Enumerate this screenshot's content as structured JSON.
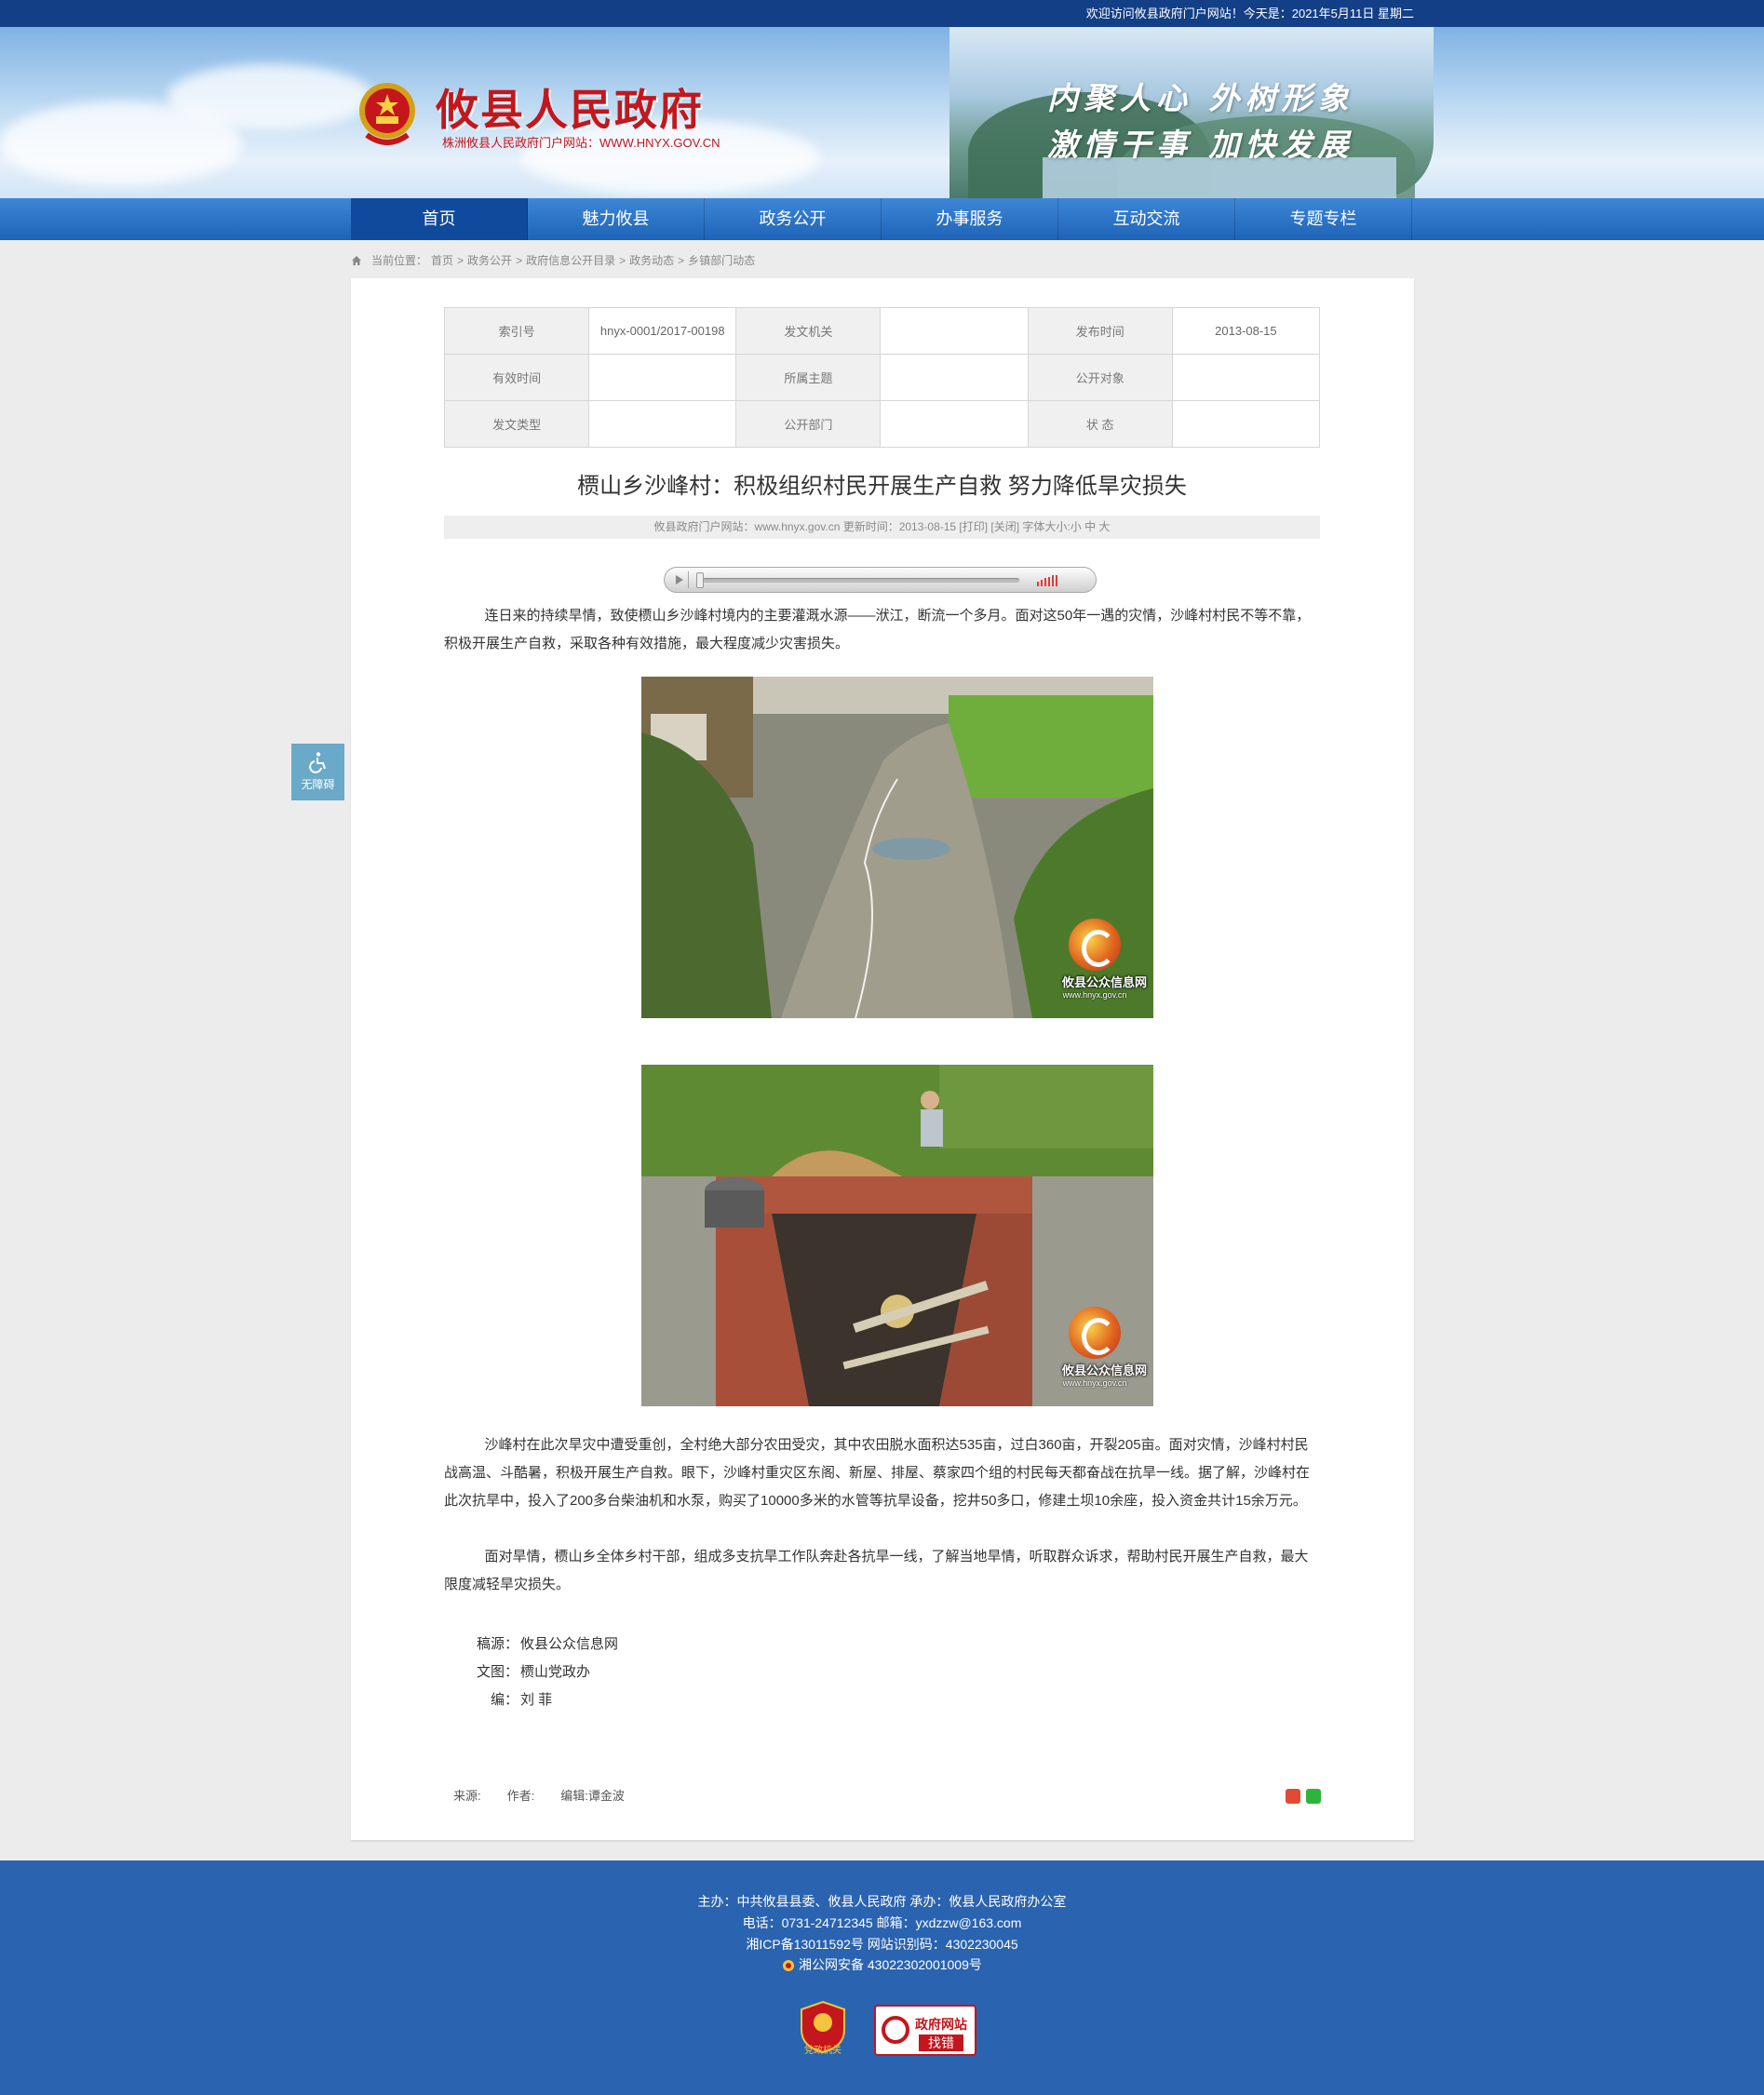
{
  "topbar": {
    "welcome": "欢迎访问攸县政府门户网站！今天是：2021年5月11日 星期二"
  },
  "header": {
    "site_title": "攸县人民政府",
    "site_subtitle": "株洲攸县人民政府门户网站：WWW.HNYX.GOV.CN",
    "slogan_line1": "内聚人心  外树形象",
    "slogan_line2": "激情干事  加快发展",
    "brand_red": "#c4161c",
    "nav_blue": "#1e63b7"
  },
  "nav": {
    "items": [
      "首页",
      "魅力攸县",
      "政务公开",
      "办事服务",
      "互动交流",
      "专题专栏"
    ]
  },
  "breadcrumb": {
    "prefix": "当前位置：",
    "items": [
      "首页",
      "政务公开",
      "政府信息公开目录",
      "政务动态",
      "乡镇部门动态"
    ],
    "separator": ">"
  },
  "meta": {
    "rows": [
      [
        {
          "k": "索引号",
          "v": "hnyx-0001/2017-00198"
        },
        {
          "k": "发文机关",
          "v": ""
        },
        {
          "k": "发布时间",
          "v": "2013-08-15"
        }
      ],
      [
        {
          "k": "有效时间",
          "v": ""
        },
        {
          "k": "所属主题",
          "v": ""
        },
        {
          "k": "公开对象",
          "v": ""
        }
      ],
      [
        {
          "k": "发文类型",
          "v": ""
        },
        {
          "k": "公开部门",
          "v": ""
        },
        {
          "k": "状  态",
          "v": ""
        }
      ]
    ]
  },
  "article": {
    "title": "槚山乡沙峰村：积极组织村民开展生产自救 努力降低旱灾损失",
    "info": "攸县政府门户网站：www.hnyx.gov.cn   更新时间：2013-08-15  [打印] [关闭]  字体大小:小 中 大",
    "para1": "连日来的持续旱情，致使槚山乡沙峰村境内的主要灌溉水源——洑江，断流一个多月。面对这50年一遇的灾情，沙峰村村民不等不靠，积极开展生产自救，采取各种有效措施，最大程度减少灾害损失。",
    "para2": "沙峰村在此次旱灾中遭受重创，全村绝大部分农田受灾，其中农田脱水面积达535亩，过白360亩，开裂205亩。面对灾情，沙峰村村民战高温、斗酷暑，积极开展生产自救。眼下，沙峰村重灾区东阁、新屋、排屋、蔡家四个组的村民每天都奋战在抗旱一线。据了解，沙峰村在此次抗旱中，投入了200多台柴油机和水泵，购买了10000多米的水管等抗旱设备，挖井50多口，修建土坝10余座，投入资金共计15余万元。",
    "para3": "面对旱情，槚山乡全体乡村干部，组成多支抗旱工作队奔赴各抗旱一线，了解当地旱情，听取群众诉求，帮助村民开展生产自救，最大限度减轻旱灾损失。",
    "watermark_text": "攸县公众信息网",
    "watermark_url": "www.hnyx.gov.cn",
    "credits": [
      {
        "k": "稿源：",
        "v": "攸县公众信息网"
      },
      {
        "k": "文图：",
        "v": "槚山党政办"
      },
      {
        "k": "编：",
        "v": "刘  菲"
      }
    ],
    "source_label": "来源:",
    "author_label": "作者:",
    "editor_label": "编辑:谭金波"
  },
  "accessibility": {
    "label": "无障碍"
  },
  "footer": {
    "line1": "主办：中共攸县县委、攸县人民政府  承办：攸县人民政府办公室",
    "line2": "电话：0731-24712345  邮箱：yxdzzw@163.com",
    "line3": "湘ICP备13011592号    网站识别码：4302230045",
    "line4": "湘公网安备 43022302001009号",
    "badge1_label": "党政机关",
    "badge2_top": "政府网站",
    "badge2_bottom": "找错"
  }
}
